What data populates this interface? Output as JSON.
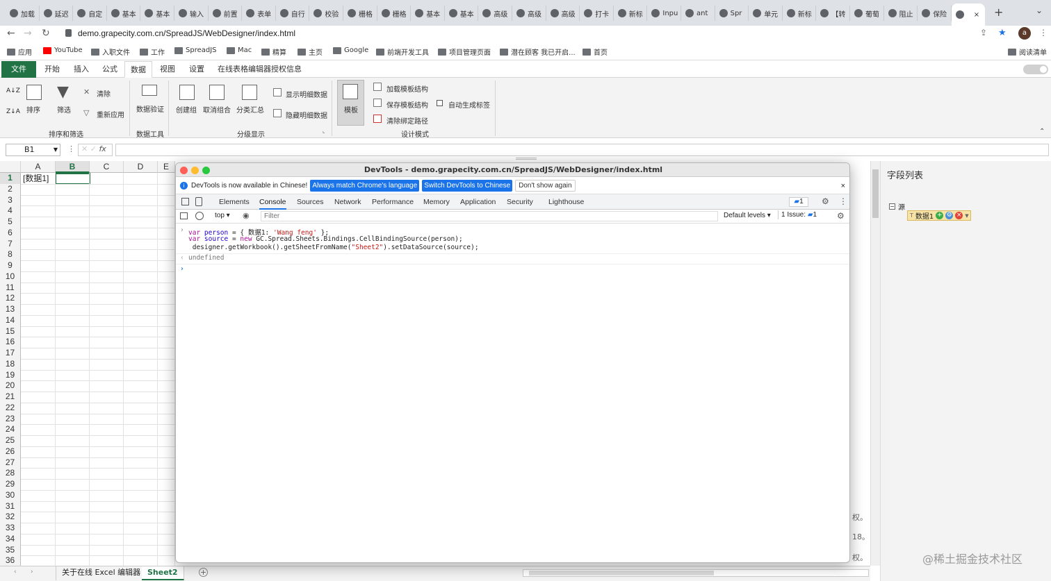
{
  "browser": {
    "tabs": [
      "加载",
      "延迟",
      "自定",
      "基本",
      "基本",
      "输入",
      "前置",
      "表单",
      "自行",
      "校验",
      "栅格",
      "栅格",
      "基本",
      "基本",
      "高级",
      "高级",
      "高级",
      "打卡",
      "新标",
      "Inpu",
      "ant",
      "Spr",
      "单元",
      "新标",
      "【转",
      "葡萄",
      "阻止",
      "保险",
      ""
    ],
    "url": "demo.grapecity.com.cn/SpreadJS/WebDesigner/index.html",
    "profile_initial": "a",
    "bookmarks": [
      "应用",
      "YouTube",
      "入职文件",
      "工作",
      "SpreadJS",
      "Mac",
      "精算",
      "主页",
      "Google",
      "前端开发工具",
      "项目管理页面",
      "潜在顾客 我已开启...",
      "首页"
    ],
    "reading_list": "阅读清单"
  },
  "ribbon": {
    "tabs": [
      "文件",
      "开始",
      "插入",
      "公式",
      "数据",
      "视图",
      "设置",
      "在线表格编辑器授权信息"
    ],
    "active_tab": "数据",
    "sort_filter": {
      "sort": "排序",
      "filter": "筛选",
      "clear": "清除",
      "reapply": "重新应用",
      "group_label": "排序和筛选"
    },
    "data_tools": {
      "validation": "数据验证",
      "group_label": "数据工具"
    },
    "outline": {
      "create_group": "创建组",
      "ungroup": "取消组合",
      "subtotal": "分类汇总",
      "show_detail": "显示明细数据",
      "hide_detail": "隐藏明细数据",
      "group_label": "分级显示"
    },
    "design": {
      "template": "模板",
      "load_template": "加载模板结构",
      "save_template": "保存模板结构",
      "clear_path": "清除绑定路径",
      "auto_label": "自动生成标签",
      "group_label": "设计模式"
    }
  },
  "formula_bar": {
    "name_box": "B1",
    "fx": "fx",
    "value": ""
  },
  "sheet": {
    "columns": [
      "A",
      "B",
      "C",
      "D",
      "E"
    ],
    "rows": [
      "1",
      "2",
      "3",
      "4",
      "5",
      "6",
      "7",
      "8",
      "9",
      "10",
      "11",
      "12",
      "13",
      "14",
      "15",
      "16",
      "17",
      "18",
      "19",
      "20",
      "21",
      "22",
      "23",
      "24",
      "25",
      "26",
      "27",
      "28",
      "29",
      "30",
      "31",
      "32",
      "33",
      "34",
      "35",
      "36"
    ],
    "cell_a1": "[数据1]",
    "selected_cell": "B1",
    "tabs": [
      "关于在线 Excel 编辑器",
      "Sheet2"
    ],
    "active_tab": "Sheet2",
    "right_fragments": [
      "权。",
      "18。",
      "权。"
    ]
  },
  "field_panel": {
    "title": "字段列表",
    "root": "源",
    "item": "数据1",
    "watermark": "@稀土掘金技术社区"
  },
  "devtools": {
    "title": "DevTools - demo.grapecity.com.cn/SpreadJS/WebDesigner/index.html",
    "info_text": "DevTools is now available in Chinese!",
    "info_btn1": "Always match Chrome's language",
    "info_btn2": "Switch DevTools to Chinese",
    "info_btn3": "Don't show again",
    "tabs": [
      "Elements",
      "Console",
      "Sources",
      "Network",
      "Performance",
      "Memory",
      "Application",
      "Security",
      "Lighthouse"
    ],
    "active_tab": "Console",
    "message_count": "1",
    "context": "top",
    "filter_placeholder": "Filter",
    "levels": "Default levels",
    "issues": "1 Issue:",
    "issue_count": "1",
    "result": "undefined"
  },
  "colors": {
    "excel_green": "#217346",
    "devtools_blue": "#1a73e8"
  }
}
